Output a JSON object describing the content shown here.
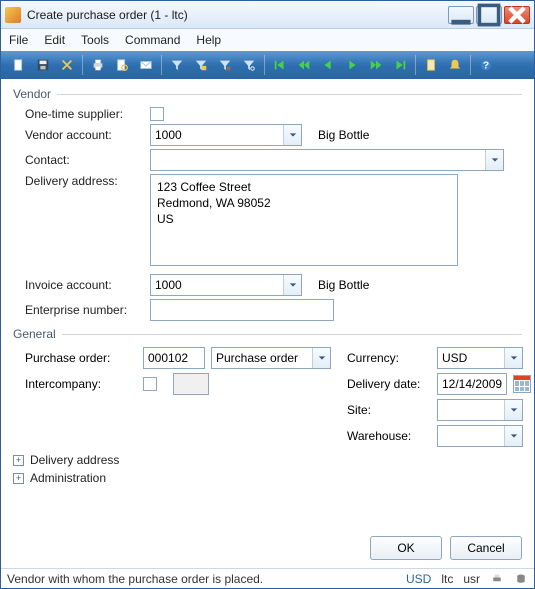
{
  "window": {
    "title": "Create purchase order (1 - ltc)"
  },
  "menu": {
    "file": "File",
    "edit": "Edit",
    "tools": "Tools",
    "command": "Command",
    "help": "Help"
  },
  "vendor_section": {
    "legend": "Vendor",
    "one_time_label": "One-time supplier:",
    "vendor_account_label": "Vendor account:",
    "vendor_account_value": "1000",
    "vendor_account_display": "Big Bottle",
    "contact_label": "Contact:",
    "contact_value": "",
    "delivery_address_label": "Delivery address:",
    "delivery_address_value": "123 Coffee Street\nRedmond, WA 98052\nUS",
    "invoice_account_label": "Invoice account:",
    "invoice_account_value": "1000",
    "invoice_account_display": "Big Bottle",
    "enterprise_number_label": "Enterprise number:",
    "enterprise_number_value": ""
  },
  "general_section": {
    "legend": "General",
    "purchase_order_label": "Purchase order:",
    "purchase_order_value": "000102",
    "purchase_type_value": "Purchase order",
    "intercompany_label": "Intercompany:",
    "intercompany_aux_value": "",
    "currency_label": "Currency:",
    "currency_value": "USD",
    "delivery_date_label": "Delivery date:",
    "delivery_date_value": "12/14/2009",
    "site_label": "Site:",
    "site_value": "",
    "warehouse_label": "Warehouse:",
    "warehouse_value": ""
  },
  "expanders": {
    "delivery_address": "Delivery address",
    "administration": "Administration"
  },
  "buttons": {
    "ok": "OK",
    "cancel": "Cancel"
  },
  "status": {
    "message": "Vendor with whom the purchase order is placed.",
    "currency": "USD",
    "company": "ltc",
    "user": "usr"
  },
  "icons": {
    "new": "new-icon",
    "save": "save-icon",
    "delete_": "delete-icon",
    "print": "print-icon",
    "preview": "preview-icon",
    "send": "send-icon",
    "filter": "filter-icon",
    "filter_sel": "filter-selection-icon",
    "filter_clear": "filter-clear-icon",
    "filter_lookup": "filter-lookup-icon",
    "first": "first-icon",
    "prev": "prev-icon",
    "back": "back-icon",
    "fwd": "forward-icon",
    "next": "next-icon",
    "last": "last-icon",
    "attach": "attach-icon",
    "alert": "alert-icon",
    "help": "help-icon"
  }
}
